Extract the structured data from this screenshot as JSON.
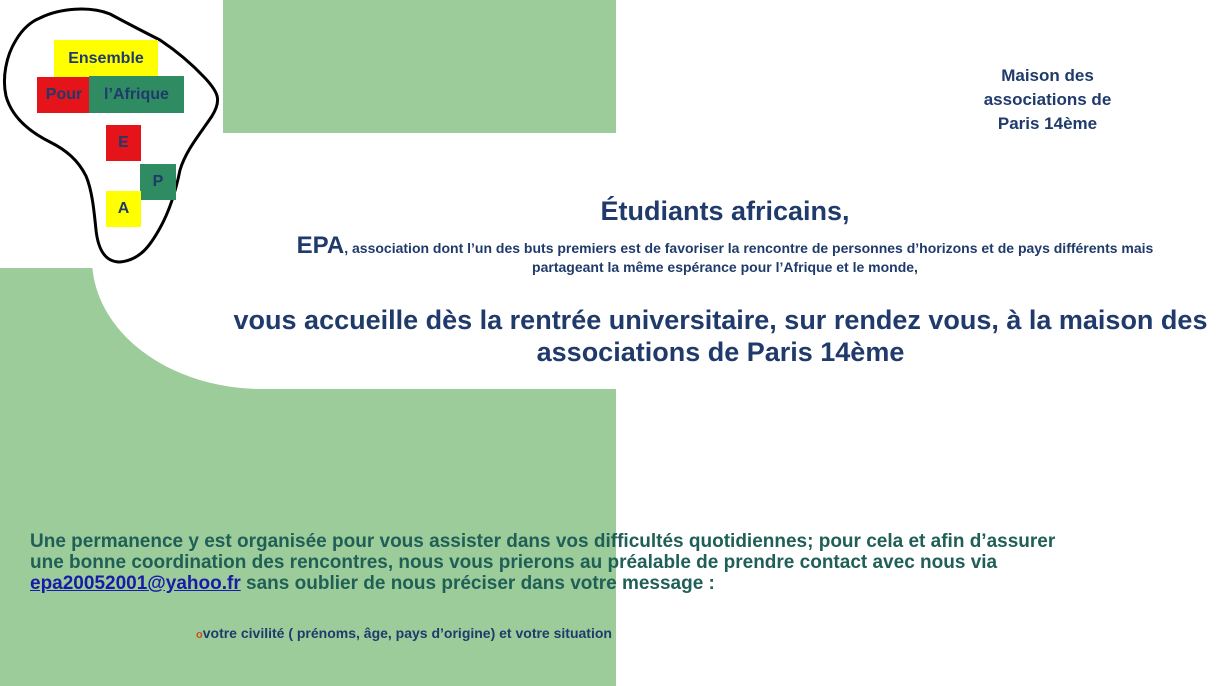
{
  "logo": {
    "ensemble": "Ensemble",
    "pour": "Pour",
    "afrique": "l’Afrique",
    "letter_e": "E",
    "letter_p": "P",
    "letter_a": "A"
  },
  "maison": {
    "line1": "Maison des",
    "line2": "associations de",
    "line3": "Paris 14ème"
  },
  "heading": "Étudiants africains,",
  "intro": {
    "epa": "EPA",
    "text_line1": ", association dont l’un des buts premiers est de favoriser la rencontre de personnes d’horizons et de pays différents mais",
    "text_line2": "partageant la même espérance pour l’Afrique et le monde,"
  },
  "accueil": {
    "line1": "vous accueille dès la rentrée universitaire, sur rendez vous, à la maison des",
    "line2": "associations de Paris 14ème"
  },
  "permanence": {
    "line1": "Une permanence y est organisée pour vous assister dans vos difficultés quotidiennes; pour cela et afin d’assurer",
    "line2": "une bonne coordination des rencontres, nous vous  prierons au préalable de prendre contact avec nous via",
    "email": "epa20052001@yahoo.fr",
    "line3_rest": " sans oublier de nous préciser dans votre message :"
  },
  "bullet": {
    "marker": "o",
    "text": "votre civilité ( prénoms, âge, pays d’origine) et votre situation"
  },
  "colors": {
    "green": "#9ccc9a",
    "navy": "#1f3a6b",
    "teal": "#1f5f57",
    "yellow": "#ffff00",
    "red": "#e5141b",
    "dark_green": "#2e8b62"
  }
}
